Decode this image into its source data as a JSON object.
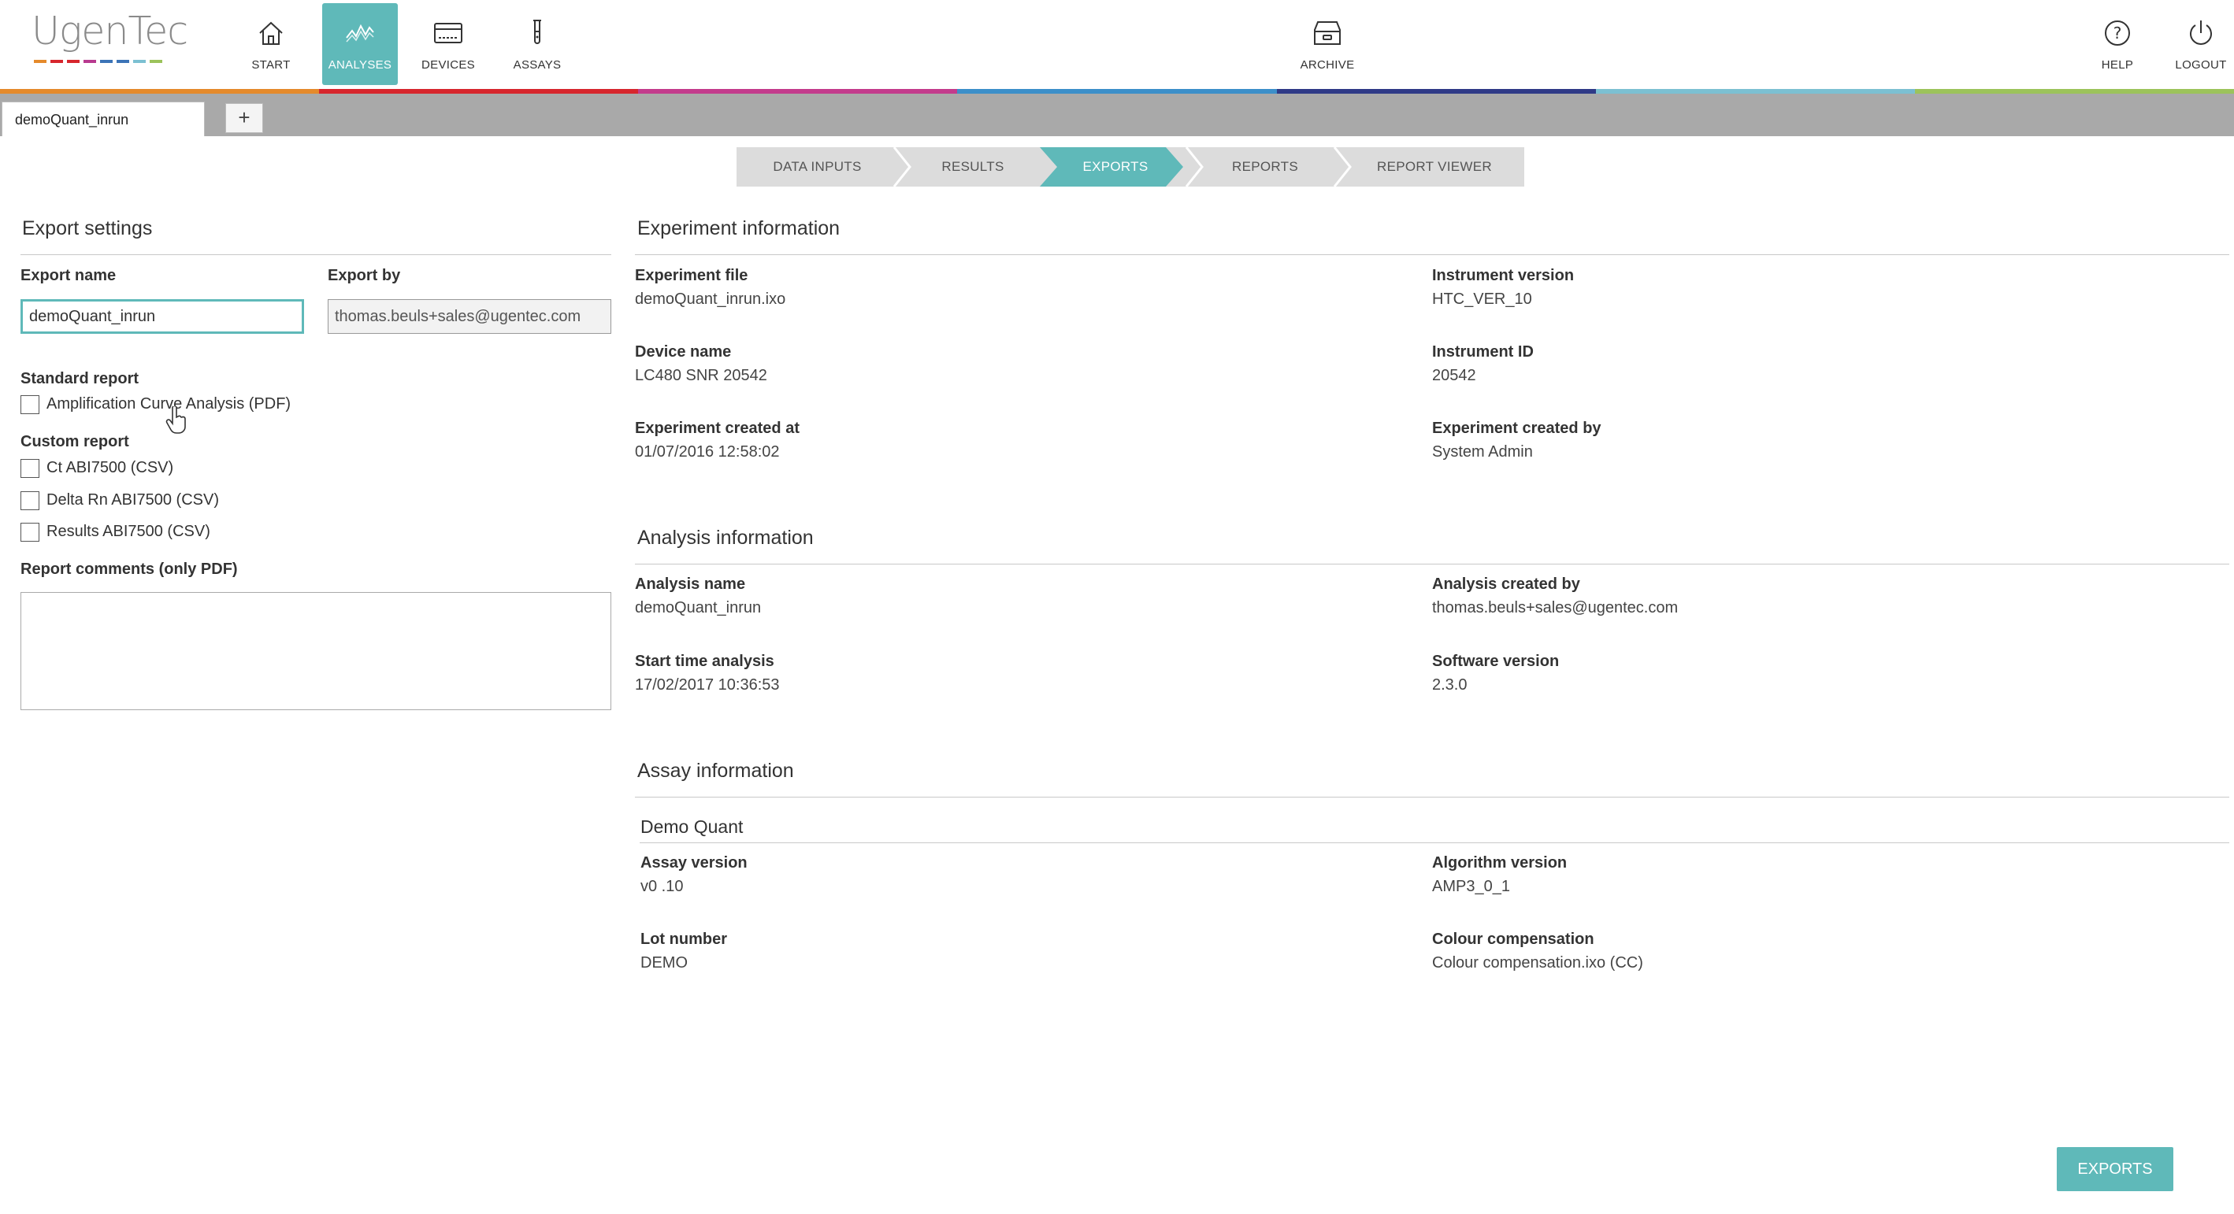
{
  "app": {
    "logo_text": "UgenTec",
    "logo_dash_colors": [
      "#e58a2b",
      "#d7262d",
      "#d7262d",
      "#b83a8f",
      "#3c74b7",
      "#3c74b7",
      "#7cc0d2",
      "#9cc35b"
    ]
  },
  "nav": {
    "start": "START",
    "analyses": "ANALYSES",
    "devices": "DEVICES",
    "assays": "ASSAYS",
    "archive": "ARCHIVE",
    "help": "HELP",
    "logout": "LOGOUT"
  },
  "colors": {
    "accent": "#5fb9b9",
    "colorbar": [
      "#e58a2b",
      "#d7262d",
      "#c33b8c",
      "#3c8fc9",
      "#2f3a87",
      "#7cc0d2",
      "#9cc35b"
    ]
  },
  "tabs": {
    "open_tab": "demoQuant_inrun",
    "add": "+"
  },
  "wizard": {
    "steps": [
      "DATA INPUTS",
      "RESULTS",
      "EXPORTS",
      "REPORTS",
      "REPORT VIEWER"
    ],
    "active": "EXPORTS"
  },
  "export_settings": {
    "title": "Export settings",
    "export_name_label": "Export name",
    "export_name_value": "demoQuant_inrun",
    "export_by_label": "Export by",
    "export_by_value": "thomas.beuls+sales@ugentec.com",
    "standard_report_label": "Standard report",
    "standard_reports": [
      "Amplification Curve Analysis (PDF)"
    ],
    "custom_report_label": "Custom report",
    "custom_reports": [
      "Ct ABI7500 (CSV)",
      "Delta Rn ABI7500 (CSV)",
      "Results ABI7500 (CSV)"
    ],
    "comments_label": "Report comments (only PDF)"
  },
  "experiment": {
    "title": "Experiment information",
    "file_label": "Experiment file",
    "file_value": "demoQuant_inrun.ixo",
    "instrument_version_label": "Instrument version",
    "instrument_version_value": "HTC_VER_10",
    "device_label": "Device name",
    "device_value": "LC480 SNR 20542",
    "instrument_id_label": "Instrument ID",
    "instrument_id_value": "20542",
    "created_at_label": "Experiment created at",
    "created_at_value": "01/07/2016 12:58:02",
    "created_by_label": "Experiment created by",
    "created_by_value": "System Admin"
  },
  "analysis": {
    "title": "Analysis information",
    "name_label": "Analysis name",
    "name_value": "demoQuant_inrun",
    "created_by_label": "Analysis created by",
    "created_by_value": "thomas.beuls+sales@ugentec.com",
    "start_label": "Start time analysis",
    "start_value": "17/02/2017 10:36:53",
    "software_label": "Software version",
    "software_value": "2.3.0"
  },
  "assay": {
    "title": "Assay information",
    "name": "Demo Quant",
    "version_label": "Assay version",
    "version_value": "v0 .10",
    "algorithm_label": "Algorithm version",
    "algorithm_value": "AMP3_0_1",
    "lot_label": "Lot number",
    "lot_value": "DEMO",
    "colour_label": "Colour compensation",
    "colour_value": "Colour compensation.ixo (CC)"
  },
  "footer": {
    "exports_button": "EXPORTS"
  }
}
